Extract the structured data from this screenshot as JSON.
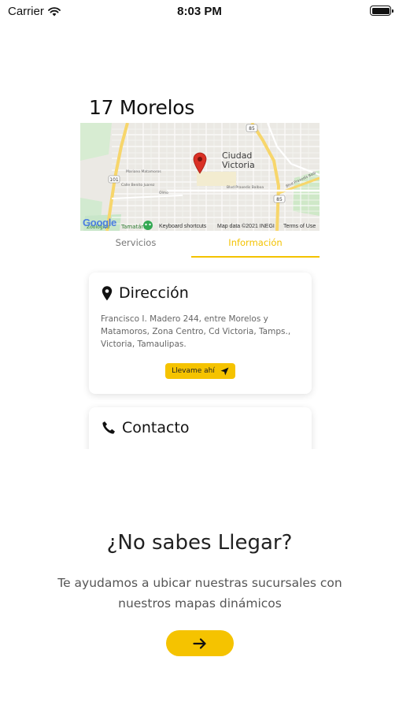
{
  "status_bar": {
    "carrier": "Carrier",
    "time": "8:03 PM",
    "wifi_icon": "wifi-icon",
    "battery_icon": "battery-icon",
    "battery_level": 1.0
  },
  "branch": {
    "title": "17 Morelos"
  },
  "map": {
    "city_label_line1": "Ciudad",
    "city_label_line2": "Victoria",
    "logo": "Google",
    "keyboard_shortcuts": "Keyboard shortcuts",
    "map_data": "Map data ©2021 INEGI",
    "terms": "Terms of Use",
    "pin_icon": "map-pin-icon",
    "road_labels": {
      "route_85": "85",
      "route_101": "101",
      "mariano": "Mariano Matamoros",
      "calle": "Calle Benito Juarez",
      "blvd": "Blvd Praxedis Balboa",
      "blvd_right": "Blvd Praxedis Balb",
      "olmo": "Olmo",
      "tamatan": "Tamatán",
      "zoologico": "Zoológico"
    }
  },
  "tabs": [
    {
      "label": "Servicios",
      "active": false
    },
    {
      "label": "Información",
      "active": true
    }
  ],
  "address_card": {
    "icon": "location-pin-icon",
    "title": "Dirección",
    "text": "Francisco I. Madero 244, entre Morelos y Matamoros, Zona Centro, Cd Victoria, Tamps., Victoria, Tamaulipas.",
    "button_label": "Llevame ahí",
    "button_icon": "navigation-arrow-icon"
  },
  "contact_card": {
    "icon": "phone-icon",
    "title": "Contacto"
  },
  "help": {
    "title": "¿No sabes Llegar?",
    "text": "Te ayudamos a ubicar nuestras sucursales con nuestros mapas dinámicos",
    "button_icon": "arrow-right-icon"
  },
  "colors": {
    "accent": "#f5c300",
    "accent_text": "#f3c200",
    "pin": "#d93025"
  }
}
